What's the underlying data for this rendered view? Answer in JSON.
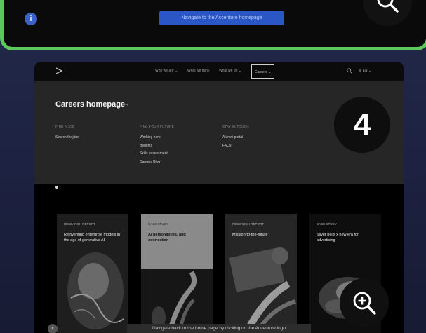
{
  "top_card": {
    "info_glyph": "i",
    "highlight_text": "Navigate to the Accenture homepage",
    "icon": "zoom-in-icon"
  },
  "nav": {
    "items": [
      "Who we are",
      "What we think",
      "What we do",
      "Careers"
    ],
    "chevrons": [
      "⌄",
      "",
      "⌄",
      "⌄"
    ],
    "active_index": 3,
    "language": "EN"
  },
  "dropdown": {
    "title": "Careers homepage",
    "title_arrow": "→",
    "columns": [
      {
        "heading": "FIND A JOB",
        "links": [
          "Search for jobs"
        ]
      },
      {
        "heading": "FIND YOUR FUTURE",
        "links": [
          "Working here",
          "Benefits",
          "Skills assessment",
          "Careers Blog"
        ]
      },
      {
        "heading": "STAY IN TOUCH",
        "links": [
          "Alumni portal",
          "FAQs"
        ]
      }
    ]
  },
  "step_badge": "4",
  "cards": [
    {
      "tag": "RESEARCH REPORT",
      "text": "Reinventing enterprise models in the age of generative AI",
      "variant": "dark"
    },
    {
      "tag": "CASE STUDY",
      "text": "AI personalities, and connection",
      "variant": "light"
    },
    {
      "tag": "RESEARCH REPORT",
      "text": "Mission-to-the-future",
      "variant": "dark"
    },
    {
      "tag": "CASE STUDY",
      "text": "Silver helix x new era for advertising",
      "variant": "dark"
    }
  ],
  "caption": "Navigate back to the home page by clicking on the Accenture logo",
  "caption_icon": "×",
  "colors": {
    "accent_green": "#5ac85a",
    "highlight_blue": "#2a56c6",
    "background": "#1c2140"
  }
}
